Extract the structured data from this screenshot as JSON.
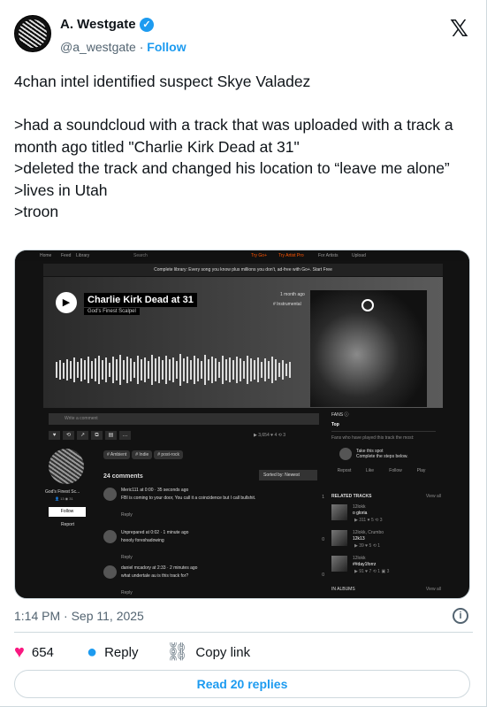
{
  "author": {
    "name": "A. Westgate",
    "handle": "@a_westgate",
    "follow_label": "Follow",
    "dot": "·"
  },
  "tweet_text": "4chan intel identified suspect Skye Valadez\n\n>had a soundcloud with a track that was uploaded with a track a month ago titled \"Charlie Kirk Dead at 31\"\n>deleted the track and changed his location to “leave me alone”\n>lives in Utah\n>troon",
  "soundcloud": {
    "nav": [
      "Home",
      "Feed",
      "Library",
      "Search",
      "Try Go+",
      "Try Artist Pro",
      "For Artists",
      "Upload"
    ],
    "banner": "Complete library: Every song you know plus millions you don't, ad-free with Go+. Start Free",
    "track_title": "Charlie Kirk Dead at 31",
    "track_artist": "God's Finest Scalpel",
    "date": "1 month ago",
    "tag": "# Instrumental",
    "comment_placeholder": "Write a comment",
    "stats": "▶ 3,654 ♥ 4 ⟲ 3",
    "tags": [
      "# Ambient",
      "# Indie",
      "# post-rock"
    ],
    "comments_label": "24 comments",
    "sort": "Sorted by: Newest",
    "profile": {
      "name": "God's Finest Sc...",
      "stats": "👤 13 ◉ 31",
      "follow": "Follow",
      "report": "Report"
    },
    "comments": [
      {
        "meta": "Meric111 at 0:00 · 35 seconds ago",
        "text": "FBI is coming to your door,\nYou call it a coincidence but I call bullshit.",
        "reply": "Reply",
        "likes": "1"
      },
      {
        "meta": "Unprepared at 0:02 · 1 minute ago",
        "text": "hoooly foreshadowing",
        "reply": "Reply",
        "likes": "0"
      },
      {
        "meta": "daniel mcadory at 2:33 · 2 minutes ago",
        "text": "what undertale au is this track for?",
        "reply": "Reply",
        "likes": "0"
      }
    ],
    "fans": {
      "title": "FANS ⓘ",
      "tab": "Top",
      "desc": "Fans who have played this track the most:",
      "spot_title": "Take this spot",
      "spot_sub": "Complete the steps below.",
      "actions": [
        "Repost",
        "Like",
        "Follow",
        "Play"
      ]
    },
    "related": {
      "title": "RELATED TRACKS",
      "view_all": "View all",
      "items": [
        {
          "user": "12lokk",
          "track": "o gloria",
          "stats": "▶ 311 ♥ 5 ⟲ 3"
        },
        {
          "user": "12lokk, Crumbo",
          "track": "12k13",
          "stats": "▶ 39 ♥ 5 ⟲ 1"
        },
        {
          "user": "12lokk",
          "track": "##day1forrz",
          "stats": "▶ 91 ♥ 7 ⟲ 1 ▣ 3"
        }
      ]
    },
    "albums": {
      "title": "IN ALBUMS",
      "view_all": "View all"
    }
  },
  "timestamp": "1:14 PM · Sep 11, 2025",
  "actions": {
    "likes": "654",
    "reply": "Reply",
    "copy": "Copy link"
  },
  "read_replies": "Read 20 replies",
  "colors": {
    "blue": "#1d9bf0",
    "pink": "#f91880",
    "gray": "#536471"
  }
}
